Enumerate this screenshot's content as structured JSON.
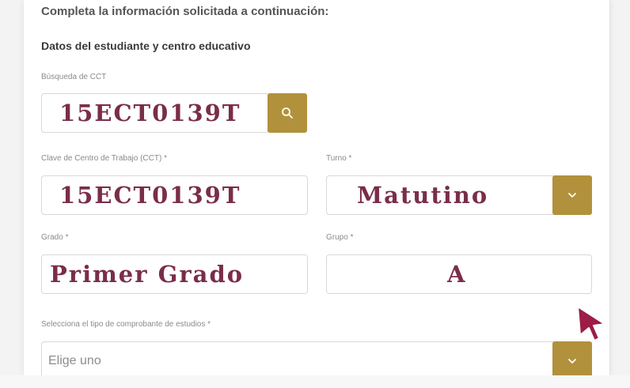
{
  "form": {
    "intro": "Completa la información solicitada a continuación:",
    "section_title": "Datos del estudiante y centro educativo",
    "cct_search": {
      "label": "Búsqueda de CCT",
      "value": "15ECT0139T",
      "button_icon": "search-icon"
    },
    "cct_key": {
      "label": "Clave de Centro de Trabajo (CCT) *",
      "value": "15ECT0139T"
    },
    "shift": {
      "label": "Turno *",
      "value": "Matutino",
      "button_icon": "chevron-down-icon"
    },
    "grade": {
      "label": "Grado *",
      "value": "Primer Grado"
    },
    "group": {
      "label": "Grupo *",
      "value": "A"
    },
    "proof_type": {
      "label": "Selecciona el tipo de comprobante de estudios *",
      "placeholder": "Elige uno",
      "button_icon": "chevron-down-icon"
    }
  },
  "colors": {
    "accent": "#b2913c",
    "value_text": "#7a2d4a",
    "cursor": "#9c1d45"
  }
}
